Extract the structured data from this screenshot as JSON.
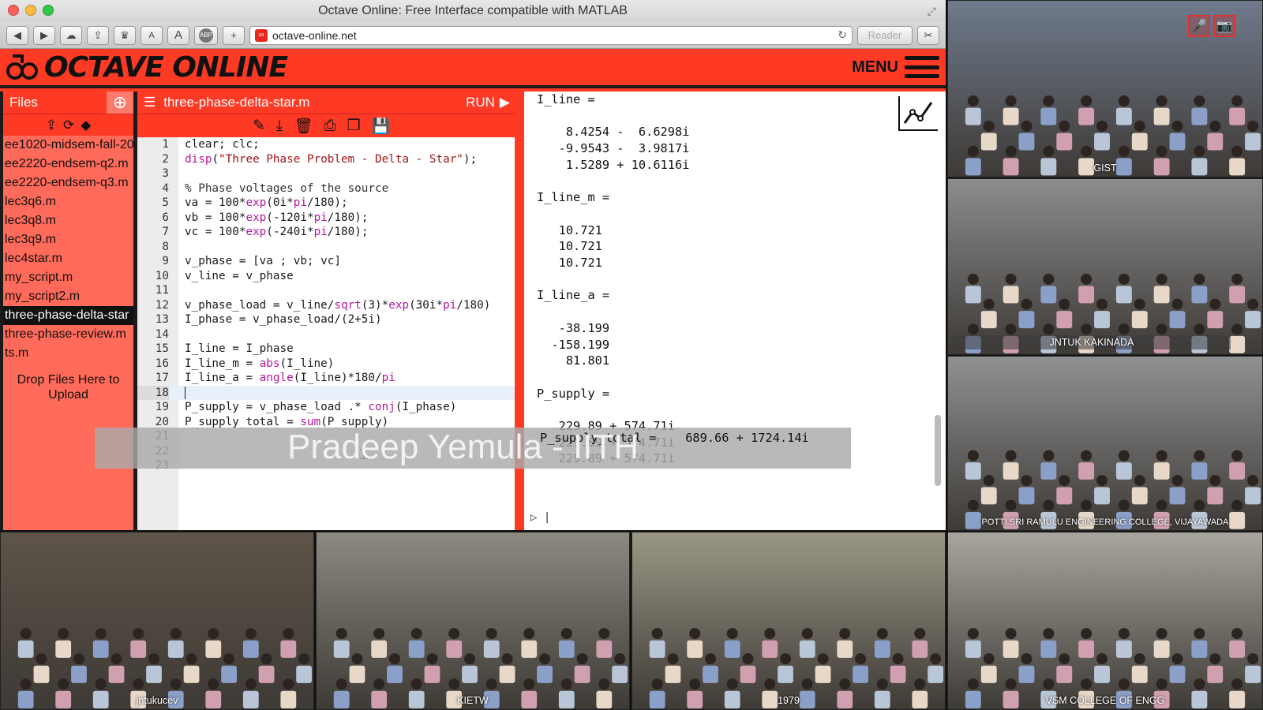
{
  "window": {
    "title": "Octave Online: Free Interface compatible with MATLAB"
  },
  "browser": {
    "url": "octave-online.net",
    "reader_label": "Reader",
    "font_small": "A",
    "font_large": "A",
    "abp": "ABP"
  },
  "app": {
    "logo_text": "OCTAVE ONLINE",
    "menu_label": "MENU"
  },
  "files": {
    "title": "Files",
    "items": [
      "ee1020-midsem-fall-20",
      "ee2220-endsem-q2.m",
      "ee2220-endsem-q3.m",
      "lec3q6.m",
      "lec3q8.m",
      "lec3q9.m",
      "lec4star.m",
      "my_script.m",
      "my_script2.m",
      "three-phase-delta-star",
      "three-phase-review.m",
      "ts.m"
    ],
    "active_index": 9,
    "drop_text_1": "Drop Files Here to",
    "drop_text_2": "Upload"
  },
  "editor": {
    "filename": "three-phase-delta-star.m",
    "run_label": "RUN",
    "current_line": 18,
    "lines": [
      "clear; clc;",
      "disp(\"Three Phase Problem - Delta - Star\");",
      "",
      "% Phase voltages of the source",
      "va = 100*exp(0i*pi/180);",
      "vb = 100*exp(-120i*pi/180);",
      "vc = 100*exp(-240i*pi/180);",
      "",
      "v_phase = [va ; vb; vc]",
      "v_line = v_phase",
      "",
      "v_phase_load = v_line/sqrt(3)*exp(30i*pi/180)",
      "I_phase = v_phase_load/(2+5i)",
      "",
      "I_line = I_phase",
      "I_line_m = abs(I_line)",
      "I_line_a = angle(I_line)*180/pi",
      "",
      "P_supply = v_phase_load .* conj(I_phase)",
      "P_supply_total = sum(P_supply)",
      "",
      "",
      ""
    ]
  },
  "output": {
    "text": "I_line =\n\n    8.4254 -  6.6298i\n   -9.9543 -  3.9817i\n    1.5289 + 10.6116i\n\nI_line_m =\n\n   10.721\n   10.721\n   10.721\n\nI_line_a =\n\n   -38.199\n  -158.199\n    81.801\n\nP_supply =\n\n   229.89 + 574.71i\n   229.89 + 574.71i\n   229.89 + 574.71i\n",
    "overlay_line": "P_supply_total =    689.66 + 1724.14i"
  },
  "caption": {
    "name": "Pradeep Yemula - IITH"
  },
  "videos": [
    {
      "label": "GIST",
      "bg": "#6f7a8c"
    },
    {
      "label": "JNTUK KAKINADA",
      "bg": "#8a8c8e"
    },
    {
      "label": "POTTI SRI RAMULU ENGINEERING COLLEGE, VIJAYAWADA",
      "bg": "#8f9192"
    },
    {
      "label": "jntukucev",
      "bg": "#5e5448"
    },
    {
      "label": "KIETW",
      "bg": "#8c8a80"
    },
    {
      "label": "1979",
      "bg": "#9b9786"
    },
    {
      "label": "VSM COLLEGE OF ENGG",
      "bg": "#a8a69e"
    }
  ],
  "colors": {
    "brand_red": "#ff3a24",
    "panel_red": "#ff6a5a",
    "dark": "#1a1a1a"
  }
}
